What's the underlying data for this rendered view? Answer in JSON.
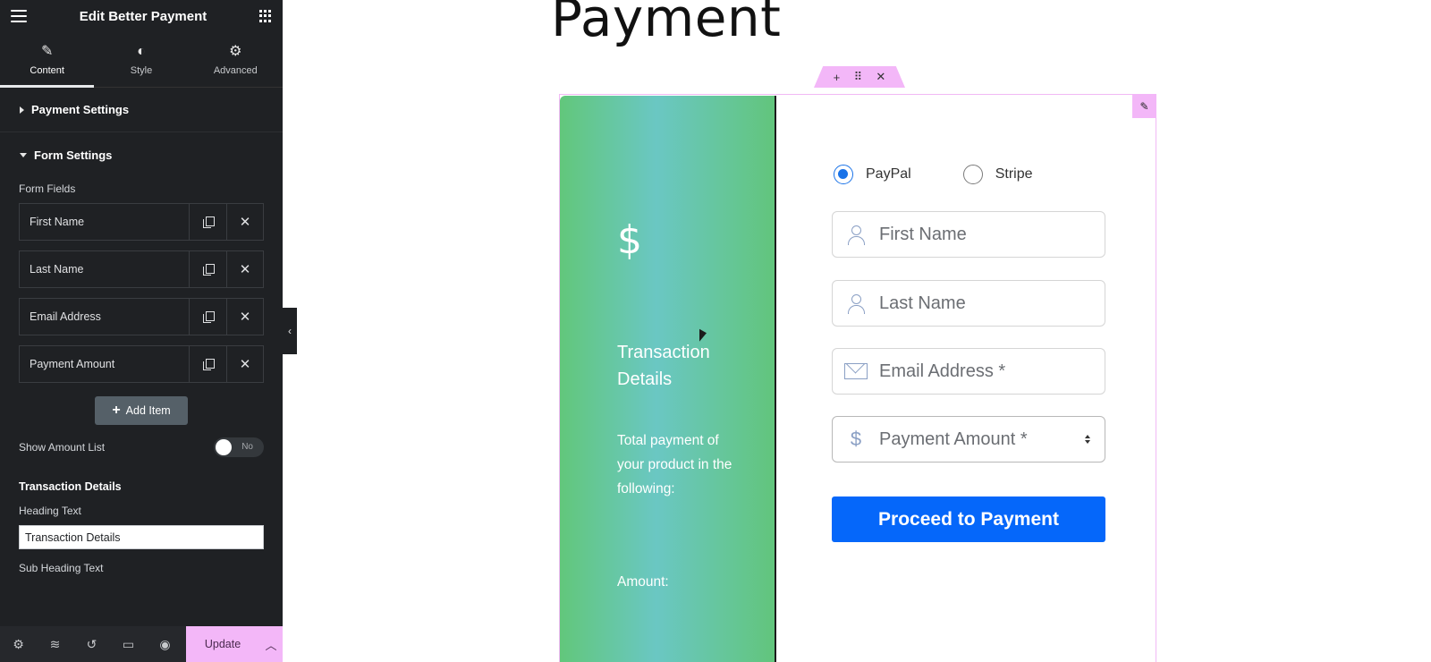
{
  "sidebar": {
    "title": "Edit Better Payment",
    "tabs": [
      {
        "label": "Content",
        "icon": "pencil-icon"
      },
      {
        "label": "Style",
        "icon": "contrast-icon"
      },
      {
        "label": "Advanced",
        "icon": "gear-icon"
      }
    ],
    "sections": {
      "payment_settings": "Payment Settings",
      "form_settings": "Form Settings"
    },
    "form_fields_label": "Form Fields",
    "form_fields": [
      {
        "label": "First Name"
      },
      {
        "label": "Last Name"
      },
      {
        "label": "Email Address"
      },
      {
        "label": "Payment Amount"
      }
    ],
    "add_item_label": "Add Item",
    "show_amount_list": {
      "label": "Show Amount List",
      "value": "No"
    },
    "transaction_details_heading": "Transaction Details",
    "heading_text": {
      "label": "Heading Text",
      "value": "Transaction Details"
    },
    "sub_heading_text_label": "Sub Heading Text",
    "footer": {
      "icons": [
        "settings-icon",
        "layers-icon",
        "history-icon",
        "responsive-icon",
        "preview-icon"
      ],
      "update_label": "Update"
    }
  },
  "preview": {
    "page_title": "Payment",
    "left_panel": {
      "currency_symbol": "$",
      "heading": "Transaction Details",
      "subtext": "Total payment of your product in the following:",
      "amount_label": "Amount:"
    },
    "payment_methods": [
      {
        "label": "PayPal",
        "checked": true
      },
      {
        "label": "Stripe",
        "checked": false
      }
    ],
    "fields": [
      {
        "placeholder": "First Name",
        "icon": "user-icon"
      },
      {
        "placeholder": "Last Name",
        "icon": "user-icon"
      },
      {
        "placeholder": "Email Address *",
        "icon": "mail-icon"
      },
      {
        "placeholder": "Payment Amount *",
        "icon": "dollar-icon",
        "icon_glyph": "$"
      }
    ],
    "submit_label": "Proceed to Payment"
  },
  "colors": {
    "accent_pink": "#f3b7f8",
    "primary_blue": "#0567fa",
    "gradient_green": "#62c77b",
    "gradient_teal": "#6ac7c3",
    "sidebar_bg": "#1f2124"
  }
}
